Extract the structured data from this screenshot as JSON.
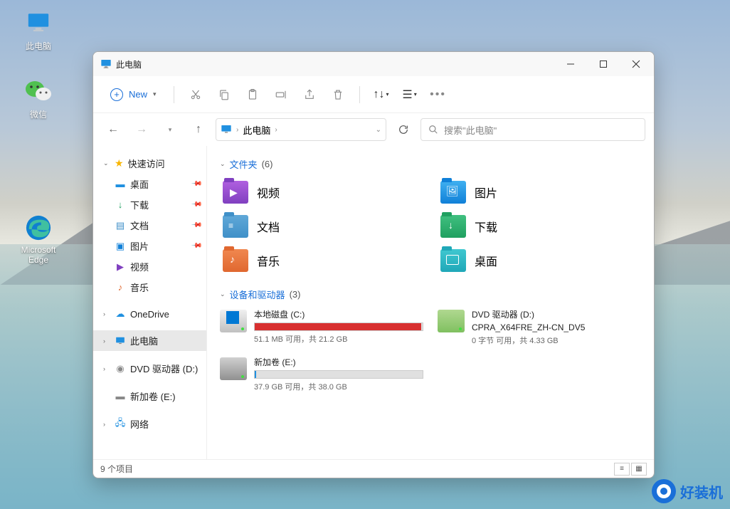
{
  "desktop": {
    "icons": {
      "this_pc": "此电脑",
      "wechat": "微信",
      "edge": "Microsoft Edge"
    }
  },
  "window": {
    "title": "此电脑",
    "toolbar": {
      "new_label": "New",
      "sort_glyph": "↑↓",
      "view_glyph": "☰"
    },
    "address": {
      "path": "此电脑",
      "crumb_sep": "›"
    },
    "search": {
      "placeholder": "搜索\"此电脑\""
    },
    "sidebar": {
      "quick_access": "快速访问",
      "desktop": "桌面",
      "downloads": "下载",
      "documents": "文档",
      "pictures": "图片",
      "videos": "视频",
      "music": "音乐",
      "onedrive": "OneDrive",
      "this_pc": "此电脑",
      "dvd": "DVD 驱动器 (D:)",
      "newvol": "新加卷 (E:)",
      "network": "网络"
    },
    "sections": {
      "folders": {
        "label": "文件夹",
        "count": "(6)"
      },
      "drives": {
        "label": "设备和驱动器",
        "count": "(3)"
      }
    },
    "folders": {
      "videos": "视频",
      "pictures": "图片",
      "documents": "文档",
      "downloads": "下载",
      "music": "音乐",
      "desktop": "桌面"
    },
    "drives": {
      "c": {
        "name": "本地磁盘 (C:)",
        "sub": "51.1 MB 可用，共 21.2 GB",
        "fill_pct": 99
      },
      "d": {
        "name": "DVD 驱动器 (D:)",
        "line2": "CPRA_X64FRE_ZH-CN_DV5",
        "sub": "0 字节 可用，共 4.33 GB"
      },
      "e": {
        "name": "新加卷 (E:)",
        "sub": "37.9 GB 可用，共 38.0 GB",
        "fill_pct": 1
      }
    },
    "status": "9 个项目"
  },
  "watermark": "好装机"
}
